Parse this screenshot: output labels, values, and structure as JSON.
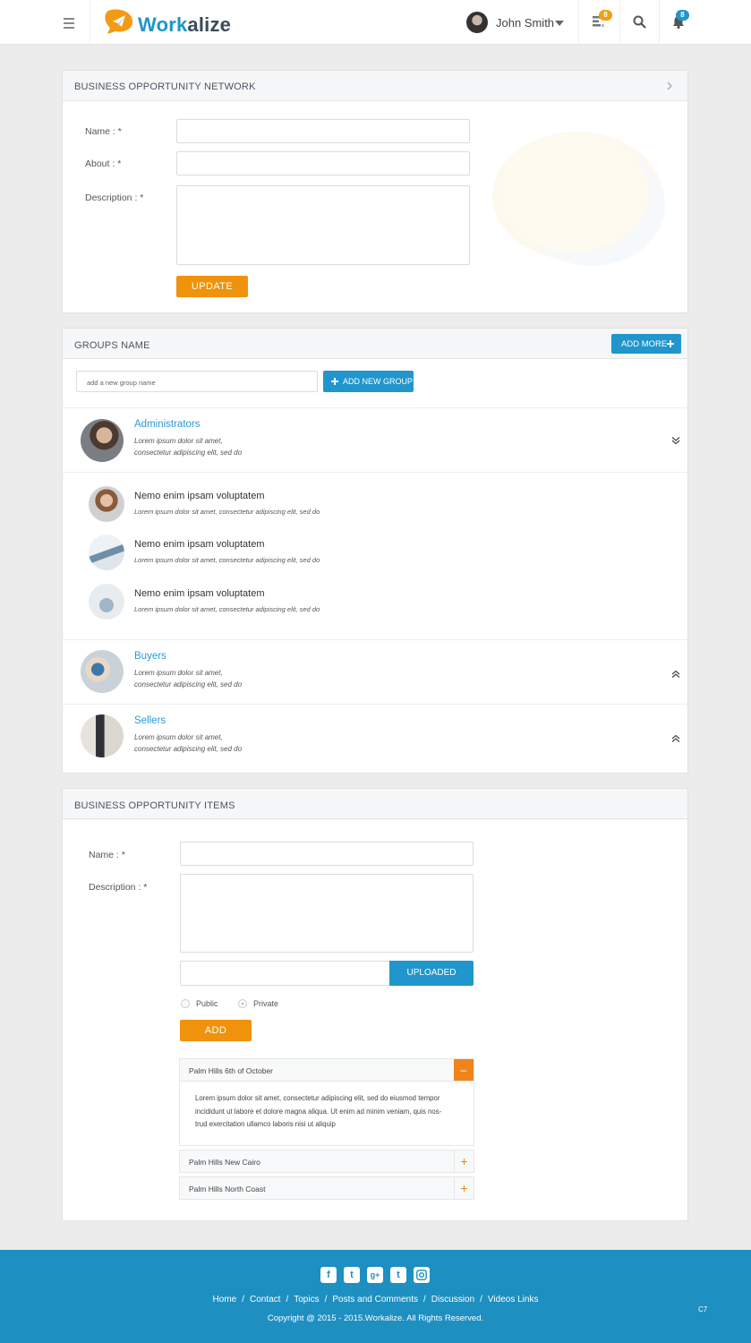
{
  "header": {
    "logo_part1": "Work",
    "logo_part2": "alize",
    "user_name": "John Smith",
    "tasks_badge": "8",
    "notifications_badge": "8"
  },
  "bon_panel": {
    "title": "BUSINESS OPPORTUNITY NETWORK",
    "name_label": "Name : *",
    "about_label": "About : *",
    "description_label": "Description : *",
    "update_button": "UPDATE"
  },
  "groups_panel": {
    "title": "GROUPS NAME",
    "add_more_button": "ADD MORE",
    "new_group_placeholder": "add a new group name",
    "add_new_group_button": "ADD NEW GROUP",
    "groups": [
      {
        "name": "Administrators",
        "desc_line1": "Lorem ipsum dolor sit amet,",
        "desc_line2": "consectetur adipiscing elit, sed do",
        "state": "expanded"
      },
      {
        "name": "Buyers",
        "desc_line1": "Lorem ipsum dolor sit amet,",
        "desc_line2": "consectetur adipiscing elit, sed do",
        "state": "collapsed"
      },
      {
        "name": "Sellers",
        "desc_line1": "Lorem ipsum dolor sit amet,",
        "desc_line2": "consectetur adipiscing elit, sed do",
        "state": "collapsed"
      }
    ],
    "members": [
      {
        "name": "Nemo enim ipsam voluptatem",
        "desc": "Lorem ipsum dolor sit amet, consectetur adipiscing elit, sed do"
      },
      {
        "name": "Nemo enim ipsam voluptatem",
        "desc": "Lorem ipsum dolor sit amet, consectetur adipiscing elit, sed do"
      },
      {
        "name": "Nemo enim ipsam voluptatem",
        "desc": "Lorem ipsum dolor sit amet, consectetur adipiscing elit, sed do"
      }
    ]
  },
  "items_panel": {
    "title": "BUSINESS OPPORTUNITY ITEMS",
    "name_label": "Name : *",
    "description_label": "Description : *",
    "upload_button": "UPLOADED",
    "public_label": "Public",
    "private_label": "Private",
    "selected_visibility": "Private",
    "add_button": "ADD",
    "accordion": [
      {
        "title": "Palm Hills 6th of October",
        "toggle": "–",
        "expanded": true,
        "body_line1": "Lorem ipsum dolor sit amet, consectetur adipiscing elit, sed do eiusmod tempor",
        "body_line2": "incididunt ut labore et dolore magna aliqua. Ut enim ad minim veniam, quis nos-",
        "body_line3": "trud exercitation ullamco laboris nisi ut aliquip"
      },
      {
        "title": "Palm Hills New Cairo",
        "toggle": "+",
        "expanded": false
      },
      {
        "title": "Palm Hills North Coast",
        "toggle": "+",
        "expanded": false
      }
    ]
  },
  "footer": {
    "social_icons": [
      "facebook-icon",
      "twitter-icon",
      "google-plus-icon",
      "tumblr-icon",
      "instagram-icon"
    ],
    "links": [
      "Home",
      "Contact",
      "Topics",
      "Posts and Comments",
      "Discussion",
      "Videos Links"
    ],
    "copyright": "Copyright @ 2015 - 2015.Workalize. All Rights Reserved.",
    "version": "C7"
  },
  "colors": {
    "brand_blue": "#2196cc",
    "accent_orange": "#f0920c",
    "footer_blue": "#1d8fc1"
  }
}
